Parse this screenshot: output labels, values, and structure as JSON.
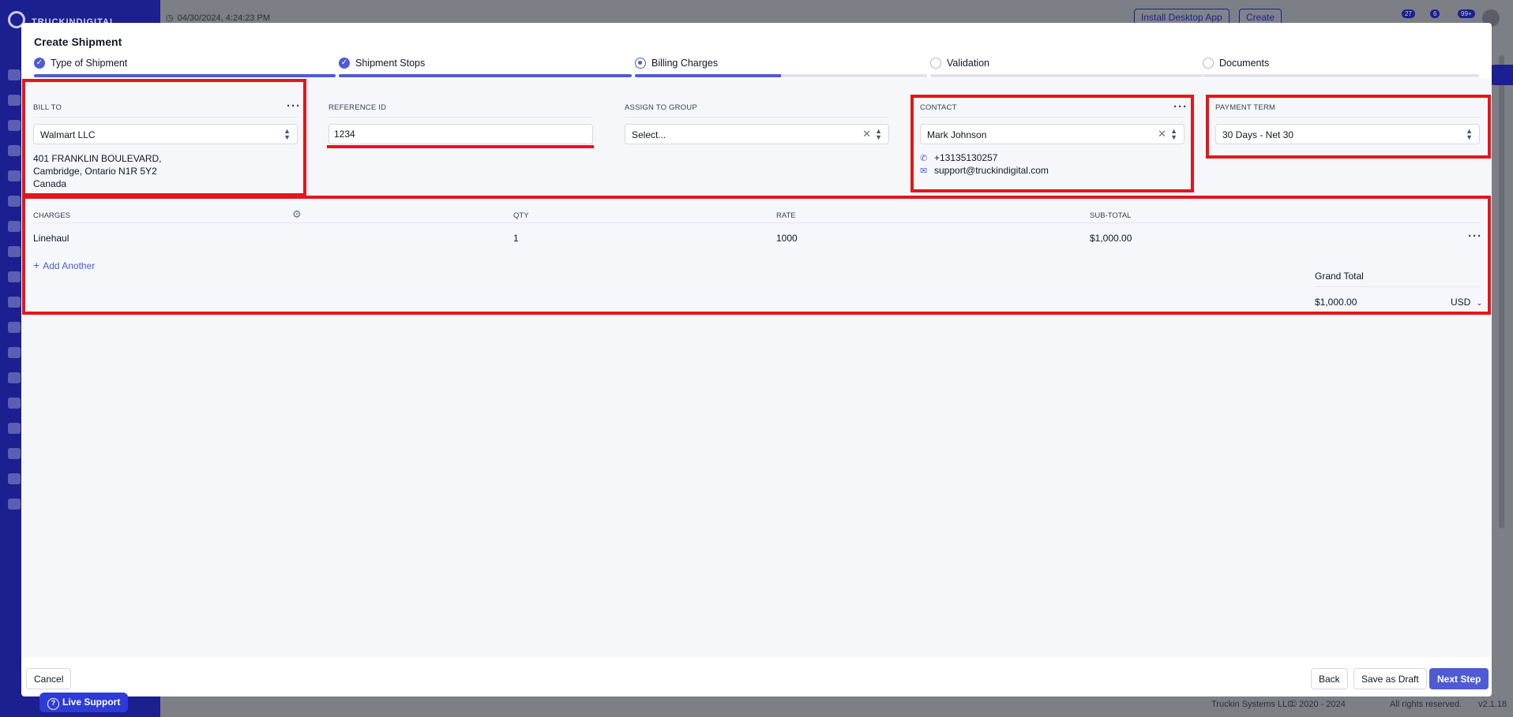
{
  "background": {
    "datetime": "04/30/2024, 4:24:23 PM",
    "brand": "TRUCKINDIGITAL",
    "install_btn": "Install Desktop App",
    "create_btn": "Create",
    "badges": [
      "27",
      "6",
      "99+"
    ],
    "live_support": "Live Support",
    "footer_company": "Truckin Systems LLC.",
    "footer_copyright": "© 2020 - 2024",
    "footer_rights": "All rights reserved.",
    "footer_version": "v2.1.18"
  },
  "modal": {
    "title": "Create Shipment",
    "steps": [
      {
        "label": "Type of Shipment",
        "status": "done"
      },
      {
        "label": "Shipment Stops",
        "status": "done"
      },
      {
        "label": "Billing Charges",
        "status": "current"
      },
      {
        "label": "Validation",
        "status": "todo"
      },
      {
        "label": "Documents",
        "status": "todo"
      }
    ],
    "bill_to": {
      "label": "BILL TO",
      "value": "Walmart LLC",
      "address": [
        "401 FRANKLIN BOULEVARD,",
        "Cambridge, Ontario N1R 5Y2",
        "Canada"
      ]
    },
    "reference_id": {
      "label": "REFERENCE ID",
      "value": "1234"
    },
    "assign_group": {
      "label": "ASSIGN TO GROUP",
      "placeholder": "Select..."
    },
    "contact": {
      "label": "CONTACT",
      "value": "Mark Johnson",
      "phone": "+13135130257",
      "email": "support@truckindigital.com"
    },
    "payment_term": {
      "label": "PAYMENT TERM",
      "value": "30 Days - Net 30"
    },
    "charges": {
      "headers": {
        "charges": "CHARGES",
        "qty": "QTY",
        "rate": "RATE",
        "subtotal": "SUB-TOTAL"
      },
      "rows": [
        {
          "name": "Linehaul",
          "qty": "1",
          "rate": "1000",
          "subtotal": "$1,000.00"
        }
      ],
      "add_another": "Add Another",
      "grand_total_label": "Grand Total",
      "grand_total_value": "$1,000.00",
      "currency": "USD"
    },
    "buttons": {
      "cancel": "Cancel",
      "back": "Back",
      "save_draft": "Save as Draft",
      "next": "Next Step"
    }
  },
  "colors": {
    "accent": "#4f5bd5",
    "highlight": "#e3171c",
    "sidebar": "#1b1f8f"
  }
}
